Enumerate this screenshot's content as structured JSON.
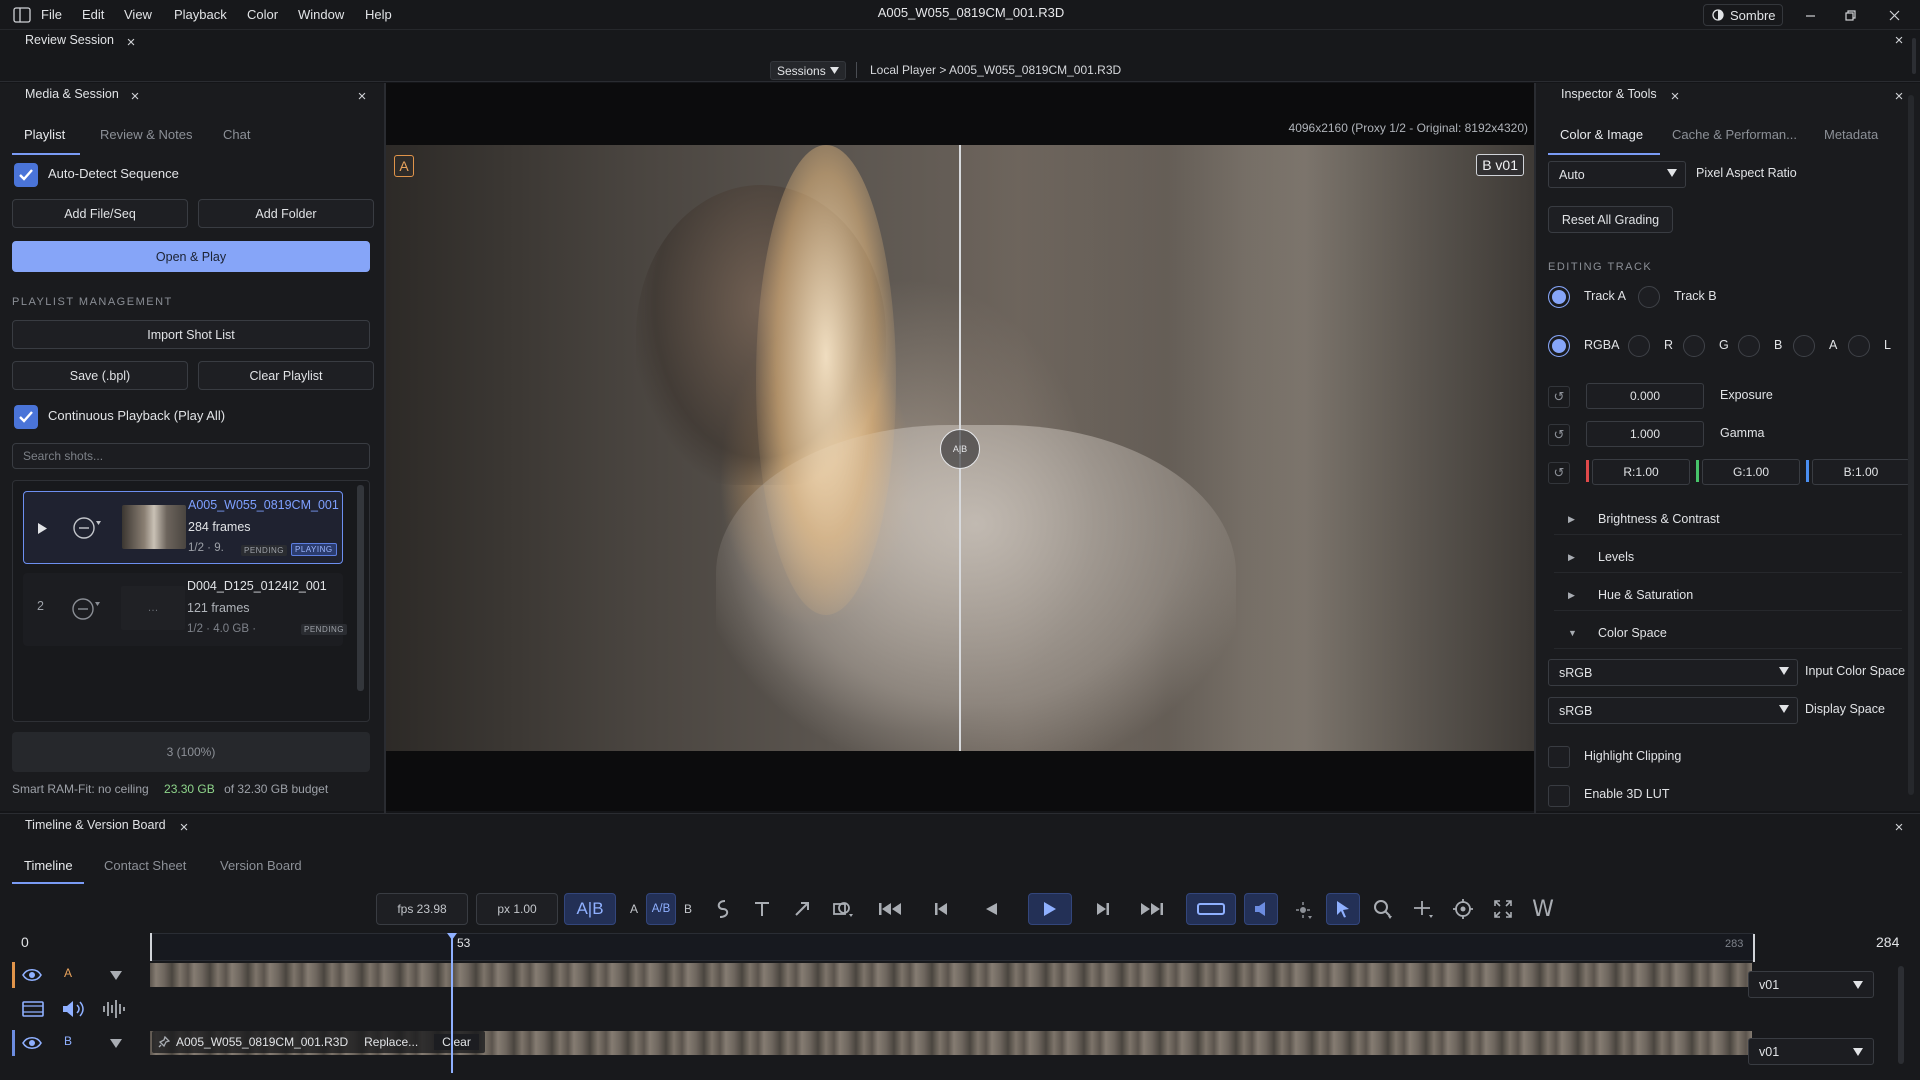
{
  "window": {
    "title": "A005_W055_0819CM_001.R3D",
    "menu": [
      "File",
      "Edit",
      "View",
      "Playback",
      "Color",
      "Window",
      "Help"
    ],
    "theme_label": "Sombre"
  },
  "review_session": {
    "tab_label": "Review Session",
    "sessions_button": "Sessions",
    "breadcrumb": "Local Player > A005_W055_0819CM_001.R3D"
  },
  "media_panel": {
    "title": "Media & Session",
    "tabs": [
      "Playlist",
      "Review & Notes",
      "Chat"
    ],
    "auto_detect_label": "Auto-Detect Sequence",
    "add_file_label": "Add File/Seq",
    "add_folder_label": "Add Folder",
    "open_play_label": "Open & Play",
    "section_label": "PLAYLIST MANAGEMENT",
    "import_label": "Import Shot List",
    "save_label": "Save (.bpl)",
    "clear_playlist_label": "Clear Playlist",
    "continuous_label": "Continuous Playback (Play All)",
    "search_placeholder": "Search shots...",
    "shots": [
      {
        "index": "",
        "name": "A005_W055_0819CM_001",
        "frames": "284 frames",
        "meta": "1/2   · 9.",
        "badge1": "PENDING",
        "badge2": "PLAYING"
      },
      {
        "index": "2",
        "name": "D004_D125_0124I2_001",
        "frames": "121 frames",
        "meta": "1/2   · 4.0 GB   ·",
        "badge1": "PENDING",
        "badge2": ""
      }
    ],
    "cache_status": "3 (100%)",
    "ram_label": "Smart RAM-Fit: no ceiling",
    "ram_used": "23.30 GB",
    "ram_budget": "of 32.30 GB budget"
  },
  "viewer": {
    "resolution_info": "4096x2160 (Proxy 1/2 - Original: 8192x4320)",
    "a_label": "A",
    "b_label": "B v01",
    "split_handle_label": "A|B"
  },
  "inspector": {
    "title": "Inspector & Tools",
    "tabs": [
      "Color & Image",
      "Cache & Performan...",
      "Metadata"
    ],
    "pixel_aspect_value": "Auto",
    "pixel_aspect_label": "Pixel Aspect Ratio",
    "reset_grading_label": "Reset All Grading",
    "editing_track_label": "EDITING TRACK",
    "track_a_label": "Track A",
    "track_b_label": "Track B",
    "channels": [
      "RGBA",
      "R",
      "G",
      "B",
      "A",
      "L"
    ],
    "exposure_value": "0.000",
    "exposure_label": "Exposure",
    "gamma_value": "1.000",
    "gamma_label": "Gamma",
    "r_value": "R:1.00",
    "g_value": "G:1.00",
    "b_value": "B:1.00",
    "groups": [
      "Brightness & Contrast",
      "Levels",
      "Hue & Saturation",
      "Color Space"
    ],
    "input_space_value": "sRGB",
    "input_space_label": "Input Color Space",
    "display_space_value": "sRGB",
    "display_space_label": "Display Space",
    "highlight_clipping_label": "Highlight Clipping",
    "enable_lut_label": "Enable 3D LUT"
  },
  "timeline": {
    "title": "Timeline & Version Board",
    "tabs": [
      "Timeline",
      "Contact Sheet",
      "Version Board"
    ],
    "fps_label": "fps 23.98",
    "px_label": "px 1.00",
    "ab_mode_labels": [
      "A",
      "A/B",
      "B"
    ],
    "start_frame": "0",
    "current_frame": "53",
    "last_frame_marker": "283",
    "end_frame": "284",
    "track_a_label": "A",
    "track_b_label": "B",
    "track_b_clip": "A005_W055_0819CM_001.R3D",
    "replace_label": "Replace...",
    "clear_label": "Clear",
    "version_a": "v01",
    "version_b": "v01"
  },
  "colors": {
    "accent": "#86a5f8",
    "background": "#141518",
    "panel": "#1a1b1e",
    "playing_badge": "#5c7ee0",
    "ram_used": "#8ed48a",
    "r_bar": "#e0494a",
    "g_bar": "#47c46a",
    "b_bar": "#4a8ef0"
  }
}
